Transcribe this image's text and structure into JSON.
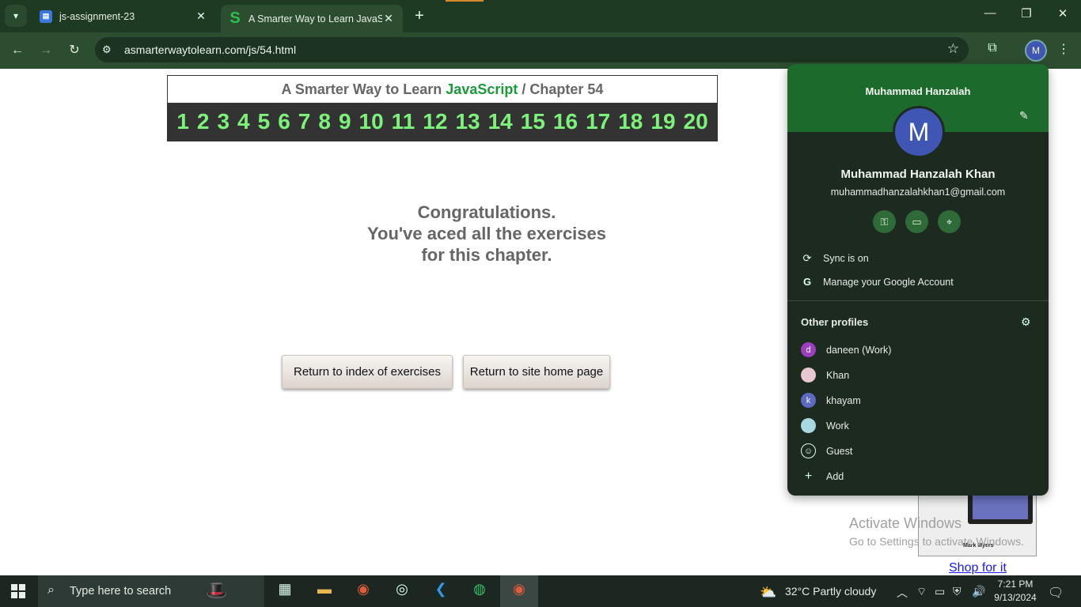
{
  "browser": {
    "tabs": [
      {
        "title": "js-assignment-23",
        "favicon": "docs-icon",
        "active": false
      },
      {
        "title": "A Smarter Way to Learn JavaScri",
        "favicon": "S",
        "active": true
      }
    ],
    "url": "asmarterwaytolearn.com/js/54.html",
    "profile_initial": "M"
  },
  "page": {
    "header_prefix": "A Smarter Way to Learn",
    "header_brand": "JavaScript",
    "header_sep": "/",
    "header_chapter": "Chapter 54",
    "chapters": [
      "1",
      "2",
      "3",
      "4",
      "5",
      "6",
      "7",
      "8",
      "9",
      "10",
      "11",
      "12",
      "13",
      "14",
      "15",
      "16",
      "17",
      "18",
      "19",
      "20"
    ],
    "congrats_line1": "Congratulations.",
    "congrats_line2": "You've aced all the exercises",
    "congrats_line3": "for this chapter.",
    "btn_index": "Return to index of exercises",
    "btn_home": "Return to site home page",
    "book_author": "Mark Myers",
    "shop_link": "Shop for it",
    "activate_line1": "Activate Windows",
    "activate_line2": "Go to Settings to activate Windows."
  },
  "profile_menu": {
    "banner_name": "Muhammad Hanzalah",
    "avatar_initial": "M",
    "full_name": "Muhammad Hanzalah Khan",
    "email": "muhammadhanzalahkhan1@gmail.com",
    "sync": "Sync is on",
    "manage": "Manage your Google Account",
    "other_profiles_header": "Other profiles",
    "other_profiles": [
      {
        "name": "daneen (Work)",
        "initial": "d",
        "color": "#9b3fc0"
      },
      {
        "name": "Khan",
        "initial": "",
        "color": "#e8c8d0"
      },
      {
        "name": "khayam",
        "initial": "k",
        "color": "#5c6bc0"
      },
      {
        "name": "Work",
        "initial": "",
        "color": "#a8d8e0"
      },
      {
        "name": "Guest",
        "initial": "",
        "color": ""
      },
      {
        "name": "Add",
        "initial": "",
        "color": ""
      }
    ]
  },
  "taskbar": {
    "search_placeholder": "Type here to search",
    "weather": "32°C  Partly cloudy",
    "time": "7:21 PM",
    "date": "9/13/2024"
  }
}
